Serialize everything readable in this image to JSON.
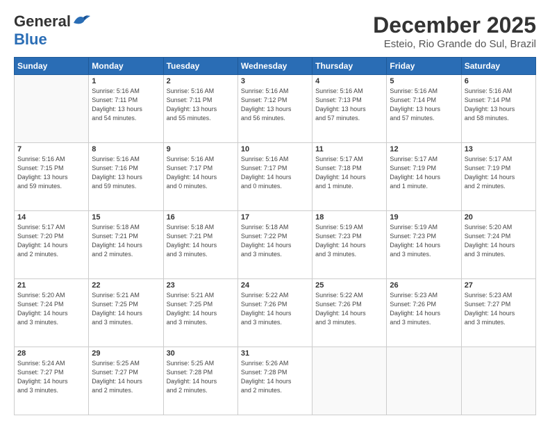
{
  "logo": {
    "general": "General",
    "blue": "Blue"
  },
  "title": "December 2025",
  "location": "Esteio, Rio Grande do Sul, Brazil",
  "days_header": [
    "Sunday",
    "Monday",
    "Tuesday",
    "Wednesday",
    "Thursday",
    "Friday",
    "Saturday"
  ],
  "weeks": [
    [
      {
        "day": "",
        "info": ""
      },
      {
        "day": "1",
        "info": "Sunrise: 5:16 AM\nSunset: 7:11 PM\nDaylight: 13 hours\nand 54 minutes."
      },
      {
        "day": "2",
        "info": "Sunrise: 5:16 AM\nSunset: 7:11 PM\nDaylight: 13 hours\nand 55 minutes."
      },
      {
        "day": "3",
        "info": "Sunrise: 5:16 AM\nSunset: 7:12 PM\nDaylight: 13 hours\nand 56 minutes."
      },
      {
        "day": "4",
        "info": "Sunrise: 5:16 AM\nSunset: 7:13 PM\nDaylight: 13 hours\nand 57 minutes."
      },
      {
        "day": "5",
        "info": "Sunrise: 5:16 AM\nSunset: 7:14 PM\nDaylight: 13 hours\nand 57 minutes."
      },
      {
        "day": "6",
        "info": "Sunrise: 5:16 AM\nSunset: 7:14 PM\nDaylight: 13 hours\nand 58 minutes."
      }
    ],
    [
      {
        "day": "7",
        "info": "Sunrise: 5:16 AM\nSunset: 7:15 PM\nDaylight: 13 hours\nand 59 minutes."
      },
      {
        "day": "8",
        "info": "Sunrise: 5:16 AM\nSunset: 7:16 PM\nDaylight: 13 hours\nand 59 minutes."
      },
      {
        "day": "9",
        "info": "Sunrise: 5:16 AM\nSunset: 7:17 PM\nDaylight: 14 hours\nand 0 minutes."
      },
      {
        "day": "10",
        "info": "Sunrise: 5:16 AM\nSunset: 7:17 PM\nDaylight: 14 hours\nand 0 minutes."
      },
      {
        "day": "11",
        "info": "Sunrise: 5:17 AM\nSunset: 7:18 PM\nDaylight: 14 hours\nand 1 minute."
      },
      {
        "day": "12",
        "info": "Sunrise: 5:17 AM\nSunset: 7:19 PM\nDaylight: 14 hours\nand 1 minute."
      },
      {
        "day": "13",
        "info": "Sunrise: 5:17 AM\nSunset: 7:19 PM\nDaylight: 14 hours\nand 2 minutes."
      }
    ],
    [
      {
        "day": "14",
        "info": "Sunrise: 5:17 AM\nSunset: 7:20 PM\nDaylight: 14 hours\nand 2 minutes."
      },
      {
        "day": "15",
        "info": "Sunrise: 5:18 AM\nSunset: 7:21 PM\nDaylight: 14 hours\nand 2 minutes."
      },
      {
        "day": "16",
        "info": "Sunrise: 5:18 AM\nSunset: 7:21 PM\nDaylight: 14 hours\nand 3 minutes."
      },
      {
        "day": "17",
        "info": "Sunrise: 5:18 AM\nSunset: 7:22 PM\nDaylight: 14 hours\nand 3 minutes."
      },
      {
        "day": "18",
        "info": "Sunrise: 5:19 AM\nSunset: 7:23 PM\nDaylight: 14 hours\nand 3 minutes."
      },
      {
        "day": "19",
        "info": "Sunrise: 5:19 AM\nSunset: 7:23 PM\nDaylight: 14 hours\nand 3 minutes."
      },
      {
        "day": "20",
        "info": "Sunrise: 5:20 AM\nSunset: 7:24 PM\nDaylight: 14 hours\nand 3 minutes."
      }
    ],
    [
      {
        "day": "21",
        "info": "Sunrise: 5:20 AM\nSunset: 7:24 PM\nDaylight: 14 hours\nand 3 minutes."
      },
      {
        "day": "22",
        "info": "Sunrise: 5:21 AM\nSunset: 7:25 PM\nDaylight: 14 hours\nand 3 minutes."
      },
      {
        "day": "23",
        "info": "Sunrise: 5:21 AM\nSunset: 7:25 PM\nDaylight: 14 hours\nand 3 minutes."
      },
      {
        "day": "24",
        "info": "Sunrise: 5:22 AM\nSunset: 7:26 PM\nDaylight: 14 hours\nand 3 minutes."
      },
      {
        "day": "25",
        "info": "Sunrise: 5:22 AM\nSunset: 7:26 PM\nDaylight: 14 hours\nand 3 minutes."
      },
      {
        "day": "26",
        "info": "Sunrise: 5:23 AM\nSunset: 7:26 PM\nDaylight: 14 hours\nand 3 minutes."
      },
      {
        "day": "27",
        "info": "Sunrise: 5:23 AM\nSunset: 7:27 PM\nDaylight: 14 hours\nand 3 minutes."
      }
    ],
    [
      {
        "day": "28",
        "info": "Sunrise: 5:24 AM\nSunset: 7:27 PM\nDaylight: 14 hours\nand 3 minutes."
      },
      {
        "day": "29",
        "info": "Sunrise: 5:25 AM\nSunset: 7:27 PM\nDaylight: 14 hours\nand 2 minutes."
      },
      {
        "day": "30",
        "info": "Sunrise: 5:25 AM\nSunset: 7:28 PM\nDaylight: 14 hours\nand 2 minutes."
      },
      {
        "day": "31",
        "info": "Sunrise: 5:26 AM\nSunset: 7:28 PM\nDaylight: 14 hours\nand 2 minutes."
      },
      {
        "day": "",
        "info": ""
      },
      {
        "day": "",
        "info": ""
      },
      {
        "day": "",
        "info": ""
      }
    ]
  ]
}
